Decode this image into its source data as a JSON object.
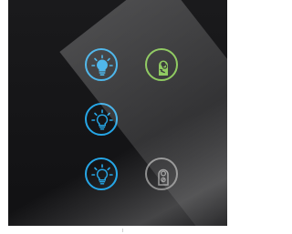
{
  "buttons": [
    {
      "icon": "lightbulb-icon",
      "state": "on",
      "color": "#26a6e6"
    },
    {
      "icon": "do-not-disturb-icon",
      "state": "active",
      "color": "#7ac043"
    },
    {
      "icon": "lightbulb-icon",
      "state": "off",
      "color": "#26a6e6"
    },
    {
      "icon": "lightbulb-icon",
      "state": "off",
      "color": "#26a6e6"
    },
    {
      "icon": "do-not-disturb-icon",
      "state": "inactive",
      "color": "#8e8e8e"
    }
  ],
  "colors": {
    "panel": "#151517",
    "light_accent": "#26a6e6",
    "dnd_active": "#7ac043",
    "dnd_inactive": "#8e8e8e"
  }
}
